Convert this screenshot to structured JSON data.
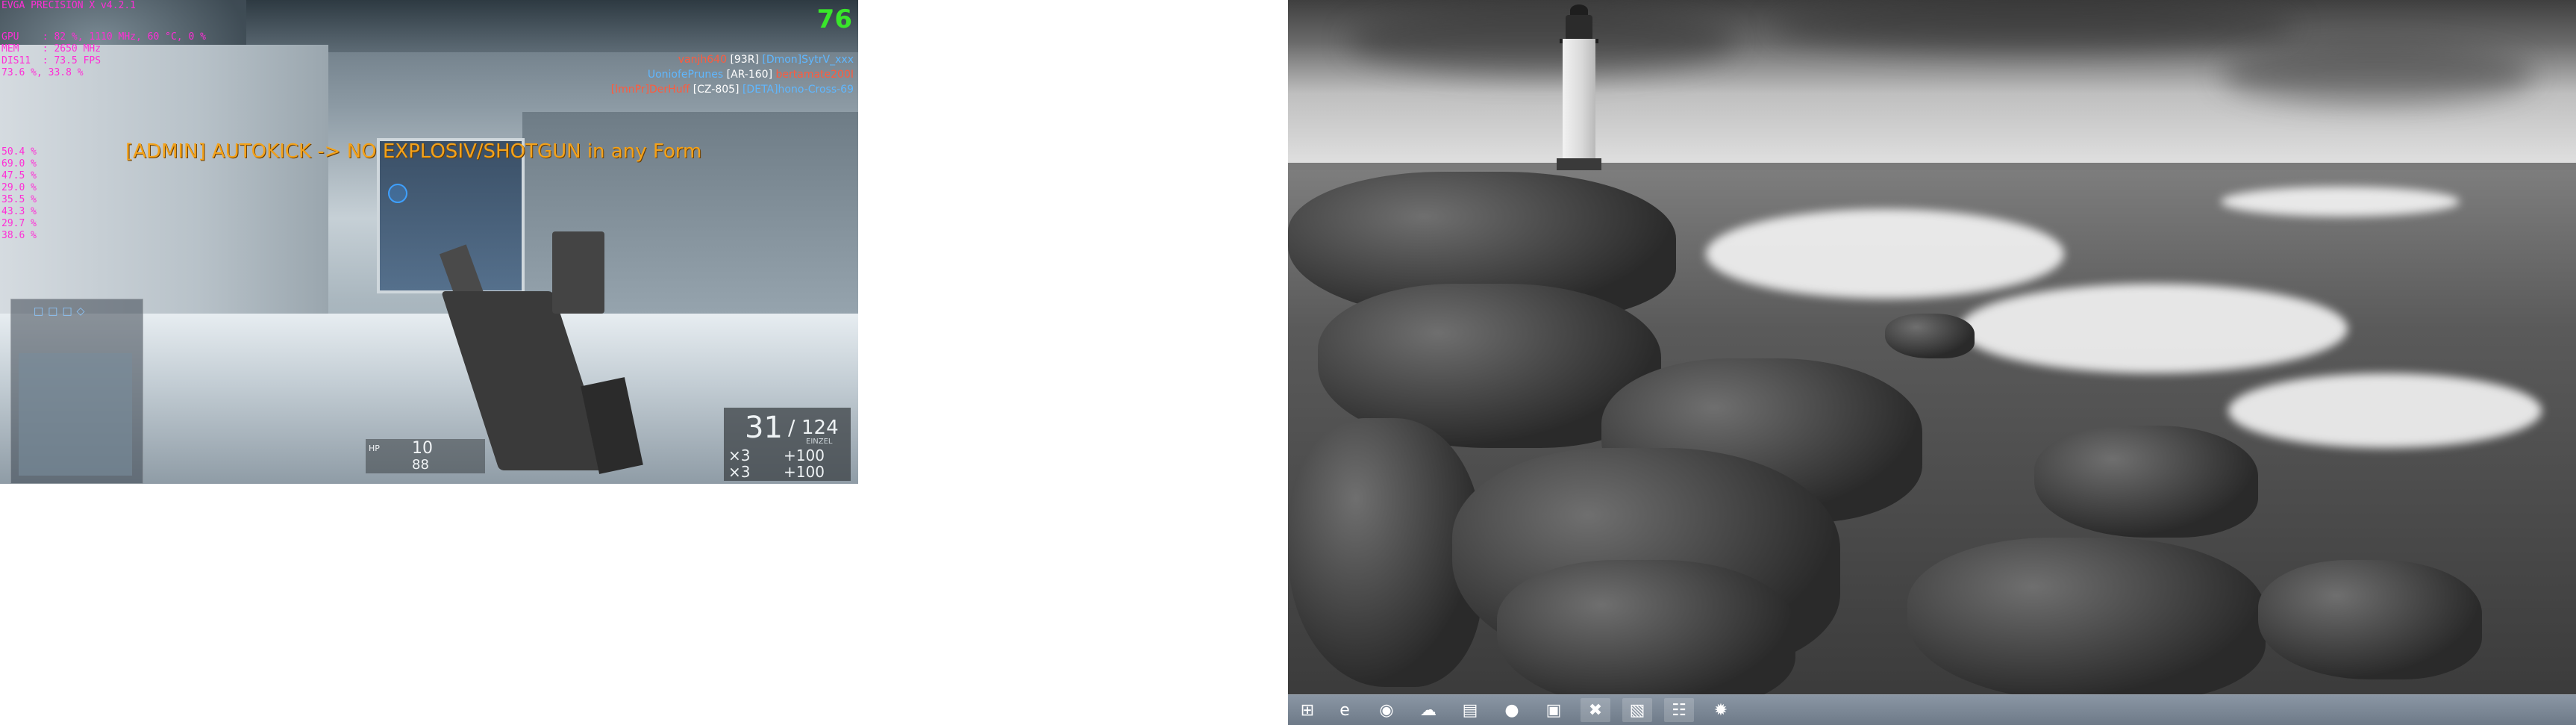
{
  "game": {
    "osd": {
      "title": "EVGA PRECISION X v4.2.1",
      "lines": [
        "GPU    : 82 %, 1110 MHz, 60 °C, 0 %",
        "MEM    : 2650 MHz",
        "DIS11  : 73.5 FPS",
        "73.6 %, 33.8 %"
      ],
      "cores": [
        "50.4 %",
        "69.0 %",
        "47.5 %",
        "29.0 %",
        "35.5 %",
        "43.3 %",
        "29.7 %",
        "38.6 %"
      ]
    },
    "fps": "76",
    "killfeed": [
      {
        "killer": "vanjh640",
        "weapon": "[93R]",
        "victim": "[Dmon]SytrV_xxx"
      },
      {
        "killer": "UoniofePrunes",
        "weapon": "[AR-160]",
        "victim": "bertamate200I"
      },
      {
        "killer": "[lmnPr]DerHuff",
        "weapon": "[CZ-805]",
        "victim": "[DETA]hono-Cross-69"
      }
    ],
    "admin_message": "[ADMIN] AUTOKICK -> NO EXPLOSIV/SHOTGUN in any Form",
    "ammo": {
      "mag": "31",
      "total": "124",
      "fire_mode": "EINZEL",
      "gadget1": "×3",
      "gadget1_count": "+100",
      "gadget2": "×3",
      "gadget2_count": "+100"
    },
    "health": {
      "label": "HP",
      "value1": "10",
      "value2": "88"
    }
  },
  "desktop": {
    "taskbar": {
      "items": [
        {
          "name": "start",
          "glyph": "⊞"
        },
        {
          "name": "internet-explorer",
          "glyph": "e"
        },
        {
          "name": "chrome",
          "glyph": "◉"
        },
        {
          "name": "app-cloud",
          "glyph": "☁"
        },
        {
          "name": "file-explorer",
          "glyph": "▤"
        },
        {
          "name": "origin",
          "glyph": "●"
        },
        {
          "name": "app-monitor",
          "glyph": "▣"
        },
        {
          "name": "app-x",
          "glyph": "✖"
        },
        {
          "name": "app-gpu",
          "glyph": "▧"
        },
        {
          "name": "app-chart",
          "glyph": "☷"
        },
        {
          "name": "app-star",
          "glyph": "✹"
        }
      ]
    }
  }
}
